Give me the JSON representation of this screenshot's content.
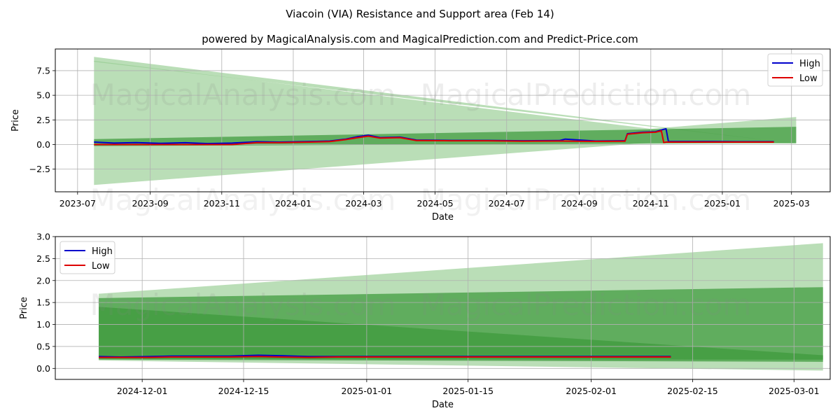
{
  "figure": {
    "title": "Viacoin (VIA) Resistance and Support area (Feb 14)",
    "subtitle": "powered by MagicalAnalysis.com and MagicalPrediction.com and Predict-Price.com",
    "watermarks": [
      "MagicalAnalysis.com",
      "MagicalPrediction.com"
    ]
  },
  "colors": {
    "high": "#0000cc",
    "low": "#dd0000",
    "band_light": "#a5d4a0",
    "band_dark": "#4a9e48",
    "grid": "#b0b0b0",
    "axis": "#000000",
    "watermark": "#c8c8c8"
  },
  "chart_data": [
    {
      "type": "line",
      "name": "full-history",
      "xlabel": "Date",
      "ylabel": "Price",
      "ylim": [
        -4.8,
        9.7
      ],
      "xlim": [
        "2023-06-12",
        "2025-04-03"
      ],
      "grid": true,
      "legend": "top-right",
      "yticks": [
        -2.5,
        0.0,
        2.5,
        5.0,
        7.5
      ],
      "ytick_labels": [
        "−2.5",
        "0.0",
        "2.5",
        "5.0",
        "7.5"
      ],
      "xticks": [
        "2023-07-01",
        "2023-09-01",
        "2023-11-01",
        "2024-01-01",
        "2024-03-01",
        "2024-05-01",
        "2024-07-01",
        "2024-09-01",
        "2024-11-01",
        "2025-01-01",
        "2025-03-01"
      ],
      "xtick_labels": [
        "2023-07",
        "2023-09",
        "2023-11",
        "2024-01",
        "2024-03",
        "2024-05",
        "2024-07",
        "2024-09",
        "2024-11",
        "2025-01",
        "2025-03"
      ],
      "bands": [
        {
          "name": "resistance-outer",
          "shade": "light",
          "x": [
            "2023-07-15",
            "2025-03-05"
          ],
          "upper": [
            8.9,
            0.1
          ],
          "lower": [
            8.4,
            0.1
          ]
        },
        {
          "name": "wide-cone-upper",
          "shade": "light",
          "x": [
            "2023-07-15",
            "2024-11-01",
            "2025-03-05"
          ],
          "upper": [
            8.5,
            1.6,
            2.8
          ],
          "lower": [
            -4.1,
            0.2,
            0.1
          ]
        },
        {
          "name": "support-channel",
          "shade": "dark",
          "x": [
            "2023-07-15",
            "2025-03-05"
          ],
          "upper": [
            0.55,
            1.8
          ],
          "lower": [
            -0.15,
            0.15
          ]
        }
      ],
      "series": [
        {
          "name": "High",
          "x": [
            "2023-07-15",
            "2023-08-01",
            "2023-08-20",
            "2023-09-10",
            "2023-10-01",
            "2023-10-20",
            "2023-11-10",
            "2023-12-01",
            "2023-12-20",
            "2024-01-15",
            "2024-02-01",
            "2024-02-15",
            "2024-02-25",
            "2024-03-05",
            "2024-03-15",
            "2024-04-01",
            "2024-04-15",
            "2024-05-15",
            "2024-06-15",
            "2024-07-15",
            "2024-08-15",
            "2024-08-20",
            "2024-09-15",
            "2024-10-10",
            "2024-10-12",
            "2024-10-25",
            "2024-11-05",
            "2024-11-12",
            "2024-11-14",
            "2024-11-16",
            "2024-12-15",
            "2025-01-15",
            "2025-02-14"
          ],
          "values": [
            0.25,
            0.15,
            0.2,
            0.12,
            0.18,
            0.1,
            0.15,
            0.28,
            0.25,
            0.3,
            0.35,
            0.55,
            0.8,
            0.95,
            0.7,
            0.75,
            0.45,
            0.42,
            0.42,
            0.38,
            0.4,
            0.55,
            0.35,
            0.38,
            1.1,
            1.25,
            1.3,
            1.55,
            1.6,
            0.3,
            0.3,
            0.28,
            0.28
          ]
        },
        {
          "name": "Low",
          "x": [
            "2023-07-15",
            "2023-08-01",
            "2023-08-20",
            "2023-09-10",
            "2023-10-01",
            "2023-10-20",
            "2023-11-10",
            "2023-12-01",
            "2023-12-20",
            "2024-01-15",
            "2024-02-01",
            "2024-02-15",
            "2024-02-25",
            "2024-03-05",
            "2024-03-15",
            "2024-04-01",
            "2024-04-15",
            "2024-05-15",
            "2024-06-15",
            "2024-07-15",
            "2024-08-15",
            "2024-09-15",
            "2024-10-10",
            "2024-10-12",
            "2024-10-25",
            "2024-11-05",
            "2024-11-10",
            "2024-11-12",
            "2024-11-14",
            "2024-12-15",
            "2025-01-15",
            "2025-02-14"
          ],
          "values": [
            0.0,
            0.0,
            0.0,
            0.0,
            0.0,
            0.0,
            0.0,
            0.2,
            0.2,
            0.25,
            0.3,
            0.5,
            0.7,
            0.85,
            0.65,
            0.7,
            0.4,
            0.38,
            0.38,
            0.34,
            0.35,
            0.32,
            0.34,
            1.05,
            1.2,
            1.25,
            1.4,
            0.2,
            0.25,
            0.25,
            0.25,
            0.25
          ]
        }
      ]
    },
    {
      "type": "line",
      "name": "zoomed-recent",
      "xlabel": "Date",
      "ylabel": "Price",
      "ylim": [
        -0.25,
        3.0
      ],
      "xlim": [
        "2024-11-19",
        "2025-03-06"
      ],
      "grid": true,
      "legend": "top-left",
      "yticks": [
        0.0,
        0.5,
        1.0,
        1.5,
        2.0,
        2.5,
        3.0
      ],
      "ytick_labels": [
        "0.0",
        "0.5",
        "1.0",
        "1.5",
        "2.0",
        "2.5",
        "3.0"
      ],
      "xticks": [
        "2024-12-01",
        "2024-12-15",
        "2025-01-01",
        "2025-01-15",
        "2025-02-01",
        "2025-02-15",
        "2025-03-01"
      ],
      "xtick_labels": [
        "2024-12-01",
        "2024-12-15",
        "2025-01-01",
        "2025-01-15",
        "2025-02-01",
        "2025-02-15",
        "2025-03-01"
      ],
      "bands": [
        {
          "name": "outer-cone",
          "shade": "light",
          "x": [
            "2024-11-25",
            "2025-03-05"
          ],
          "upper": [
            1.7,
            2.85
          ],
          "lower": [
            0.18,
            -0.05
          ]
        },
        {
          "name": "resistance-band",
          "shade": "dark",
          "x": [
            "2024-11-25",
            "2025-03-05"
          ],
          "upper": [
            1.6,
            1.85
          ],
          "lower": [
            0.2,
            0.15
          ]
        },
        {
          "name": "declining-resistance",
          "shade": "dark",
          "x": [
            "2024-11-25",
            "2025-03-05"
          ],
          "upper": [
            1.4,
            0.3
          ],
          "lower": [
            0.22,
            0.2
          ]
        }
      ],
      "series": [
        {
          "name": "High",
          "x": [
            "2024-11-25",
            "2024-11-28",
            "2024-12-02",
            "2024-12-05",
            "2024-12-09",
            "2024-12-13",
            "2024-12-17",
            "2024-12-20",
            "2024-12-24",
            "2024-12-28",
            "2025-01-01",
            "2025-01-15",
            "2025-02-01",
            "2025-02-12"
          ],
          "values": [
            0.27,
            0.26,
            0.27,
            0.28,
            0.28,
            0.28,
            0.3,
            0.29,
            0.27,
            0.27,
            0.27,
            0.27,
            0.27,
            0.27
          ]
        },
        {
          "name": "Low",
          "x": [
            "2024-11-25",
            "2024-11-28",
            "2024-12-02",
            "2024-12-05",
            "2024-12-09",
            "2024-12-13",
            "2024-12-17",
            "2024-12-20",
            "2024-12-24",
            "2024-12-28",
            "2025-01-01",
            "2025-01-15",
            "2025-02-01",
            "2025-02-12"
          ],
          "values": [
            0.25,
            0.25,
            0.25,
            0.26,
            0.26,
            0.26,
            0.27,
            0.26,
            0.25,
            0.26,
            0.26,
            0.26,
            0.26,
            0.26
          ]
        }
      ]
    }
  ]
}
